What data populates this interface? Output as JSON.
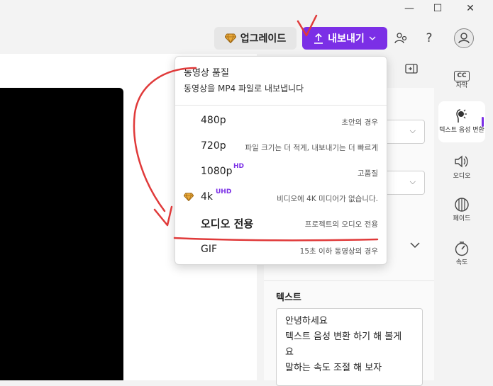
{
  "window": {
    "minimize_icon": "—",
    "maximize_icon": "☐",
    "close_icon": "✕"
  },
  "toolbar": {
    "upgrade_label": "업그레이드",
    "export_label": "내보내기",
    "help_icon": "?"
  },
  "export_menu": {
    "title": "동영상 품질",
    "subtitle": "동영상을 MP4 파일로 내보냅니다",
    "items": [
      {
        "label": "480p",
        "badge": "",
        "desc": "초안의 경우"
      },
      {
        "label": "720p",
        "badge": "",
        "desc": "파일 크기는 더 적게, 내보내기는 더 빠르게"
      },
      {
        "label": "1080p",
        "badge": "HD",
        "desc": "고품질"
      },
      {
        "label": "4k",
        "badge": "UHD",
        "desc": "비디오에 4K 미디어가 없습니다."
      },
      {
        "label": "오디오 전용",
        "badge": "",
        "desc": "프로젝트의 오디오 전용"
      },
      {
        "label": "GIF",
        "badge": "",
        "desc": "15초 이하 동영상의 경우"
      }
    ]
  },
  "props": {
    "text_label": "텍스트",
    "text_lines": [
      "안녕하세요",
      "텍스트 음성 변환 하기 해 볼게",
      "요",
      "말하는 속도 조절 해 보자"
    ]
  },
  "rail": [
    {
      "label": "자막",
      "icon": "cc-icon"
    },
    {
      "label": "텍스트 음성 변환",
      "icon": "voice-icon"
    },
    {
      "label": "오디오",
      "icon": "speaker-icon"
    },
    {
      "label": "페이드",
      "icon": "fade-icon"
    },
    {
      "label": "속도",
      "icon": "speed-icon"
    }
  ],
  "colors": {
    "accent": "#7b2fe6",
    "annotation": "#e03a3a",
    "gem": "#c98a1a"
  }
}
